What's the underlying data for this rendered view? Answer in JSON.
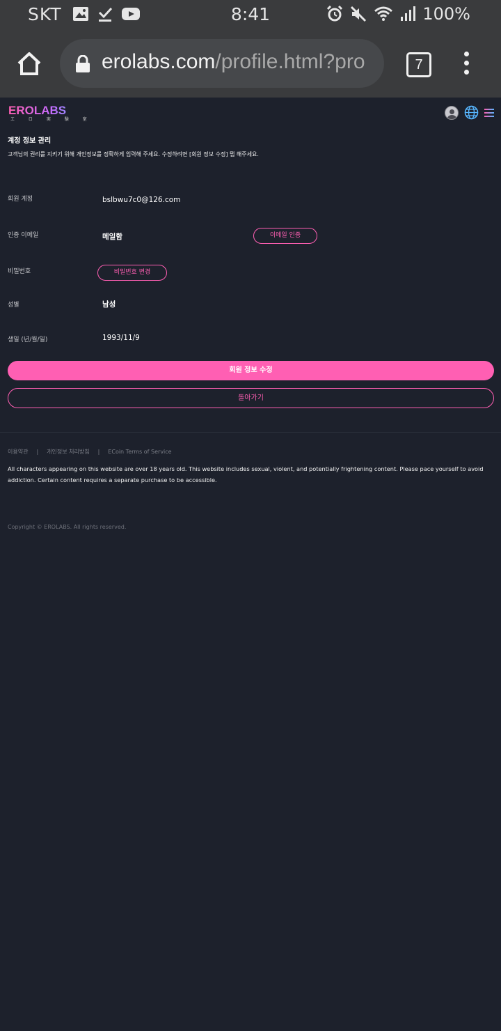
{
  "status_bar": {
    "carrier": "SKT",
    "time": "8:41",
    "battery": "100%",
    "left_icons": [
      "image-icon",
      "download-done-icon",
      "youtube-icon"
    ],
    "right_icons": [
      "alarm-icon",
      "mute-icon",
      "wifi-icon",
      "signal-icon"
    ]
  },
  "browser": {
    "url_host": "erolabs.com",
    "url_path": "/profile.html?pro",
    "tab_count": "7"
  },
  "header": {
    "logo_text": "EROLABS",
    "logo_subtext": "エ ロ 実 験 室",
    "brand_colors": [
      "#ff5fb3",
      "#c86bff",
      "#57b6ff"
    ]
  },
  "page": {
    "title": "계정 정보 관리",
    "description": "고객님의 권리를 지키기 위해 개인정보를 정확하게 입력해 주세요. 수정하려면 [회원 정보 수정] 탭 해주세요."
  },
  "fields": {
    "account_label": "회원 계정",
    "account_value": "bslbwu7c0@126.com",
    "email_label": "인증 이메일",
    "email_value": "메일함",
    "email_verify_button": "이메일 인증",
    "password_label": "비밀번호",
    "password_change_button": "비밀번호 변경",
    "gender_label": "성별",
    "gender_value": "남성",
    "birthday_label": "생일 (년/월/일)",
    "birthday_value": "1993/11/9"
  },
  "actions": {
    "edit_label": "회원 정보 수정",
    "back_label": "돌아가기",
    "accent_color": "#ff5fb3"
  },
  "footer": {
    "links": [
      "이용약관",
      "개인정보 처리방침",
      "ECoin Terms of Service"
    ],
    "separator": "|",
    "notice": "All characters appearing on this website are over 18 years old. This website includes sexual, violent, and potentially frightening content. Please pace yourself to avoid addiction. Certain content requires a separate purchase to be accessible.",
    "copyright": "Copyright © EROLABS. All rights reserved."
  }
}
